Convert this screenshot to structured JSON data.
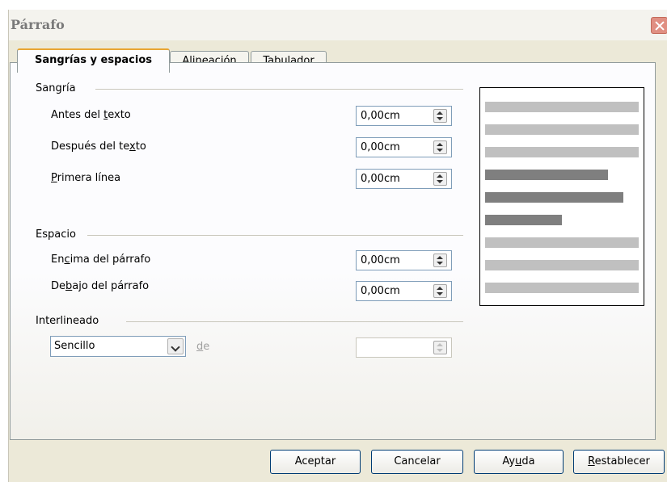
{
  "window": {
    "title": "Párrafo"
  },
  "tabs": [
    {
      "label": "Sangrías y espacios",
      "active": true
    },
    {
      "label": "Alineación",
      "active": false
    },
    {
      "label": "Tabulador",
      "active": false
    }
  ],
  "indent": {
    "section": "Sangría",
    "before": {
      "pre": "Antes del ",
      "key": "t",
      "post": "exto",
      "value": "0,00cm"
    },
    "after": {
      "pre": "Después del te",
      "key": "x",
      "post": "to",
      "value": "0,00cm"
    },
    "first": {
      "pre": "",
      "key": "P",
      "post": "rimera línea",
      "value": "0,00cm"
    }
  },
  "spacing": {
    "section": "Espacio",
    "above": {
      "pre": "En",
      "key": "c",
      "post": "ima del párrafo",
      "value": "0,00cm"
    },
    "below": {
      "pre": "De",
      "key": "b",
      "post": "ajo del párrafo",
      "value": "0,00cm"
    }
  },
  "line_spacing": {
    "section": "Interlineado",
    "selected": "Sencillo",
    "of_label": {
      "pre": "",
      "key": "d",
      "post": "e"
    },
    "of_value": ""
  },
  "buttons": {
    "ok": "Aceptar",
    "cancel": "Cancelar",
    "help": {
      "pre": "Ay",
      "key": "u",
      "post": "da"
    },
    "reset": {
      "pre": "",
      "key": "R",
      "post": "establecer"
    }
  },
  "colors": {
    "tab_accent": "#e8a532",
    "close": "#e08f82",
    "preview_dark": "#7f7f7f",
    "preview_light": "#c0c0c0"
  }
}
